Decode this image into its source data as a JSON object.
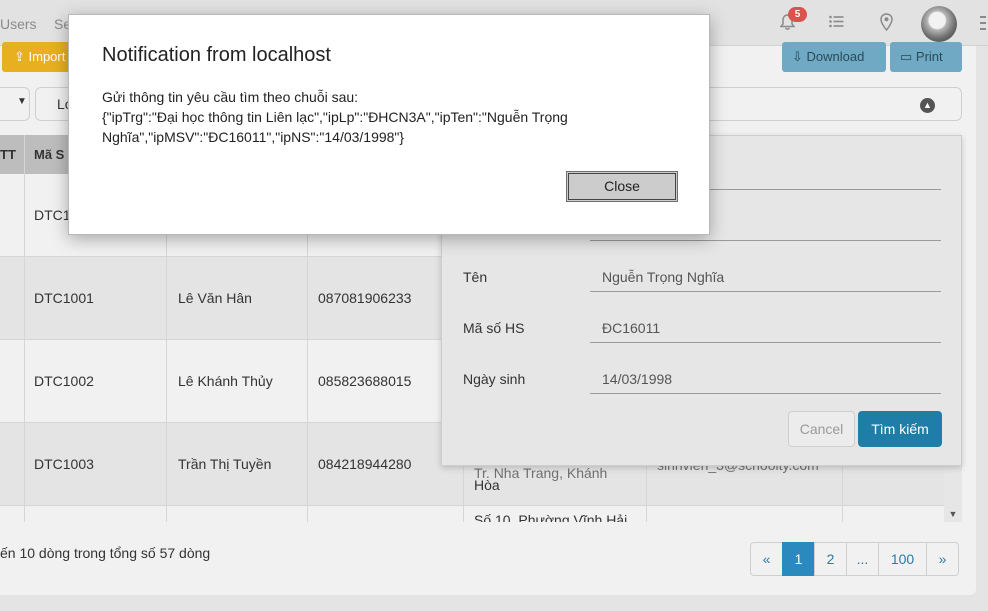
{
  "topbar": {
    "nav_users": "Users",
    "nav_se": "Se",
    "notification_count": "5",
    "icons": [
      "bell-icon",
      "list-icon",
      "location-pin-icon",
      "avatar",
      "more-vertical-icon"
    ]
  },
  "toolbar": {
    "import_label": "Import",
    "download_label": "Download",
    "print_label": "Print"
  },
  "filters": {
    "lop_label": "Lớ"
  },
  "table": {
    "headers": [
      "TT",
      "Mã S"
    ],
    "rows": [
      {
        "ma": "DTC1",
        "ten": "",
        "sdt": ""
      },
      {
        "ma": "DTC1001",
        "ten": "Lê Văn Hân",
        "sdt": "087081906233"
      },
      {
        "ma": "DTC1002",
        "ten": "Lê Khánh Thủy",
        "sdt": "085823688015"
      },
      {
        "ma": "DTC1003",
        "ten": "Trần Thị Tuyền",
        "sdt": "084218944280"
      }
    ],
    "ghost_address_1": "Tr. Nha Trang, Khánh",
    "ghost_address_2": "Hòa",
    "ghost_email": "sinhvien_3@schoolty.com",
    "ghost_address_3": "Số 10, Phường Vĩnh Hải"
  },
  "footer": {
    "summary": "ến 10 dòng trong tổng số 57 dòng",
    "pages": [
      "«",
      "1",
      "2",
      "...",
      "100",
      "»"
    ],
    "active_page": "1"
  },
  "search_form": {
    "truong_value": "Liên lạc",
    "lop_value": "",
    "ten_label": "Tên",
    "ten_value": "Nguễn Trọng Nghĩa",
    "msv_label": "Mã số HS",
    "msv_value": "ĐC16011",
    "ns_label": "Ngày sinh",
    "ns_value": "14/03/1998",
    "cancel_label": "Cancel",
    "search_label": "Tìm kiếm"
  },
  "dialog": {
    "title": "Notification from localhost",
    "message_line1": "Gửi thông tin yêu cầu tìm theo chuỗi sau:",
    "message_line2": "{\"ipTrg\":\"Đại học thông tin Liên lạc\",\"ipLp\":\"ĐHCN3A\",\"ipTen\":\"Nguễn Trọng Nghĩa\",\"ipMSV\":\"ĐC16011\",\"ipNS\":\"14/03/1998\"}",
    "close_label": "Close"
  },
  "colors": {
    "accent": "#2a8abd",
    "search_button": "#1f7ea8",
    "import_button": "#e8b020",
    "badge": "#d9534f"
  }
}
